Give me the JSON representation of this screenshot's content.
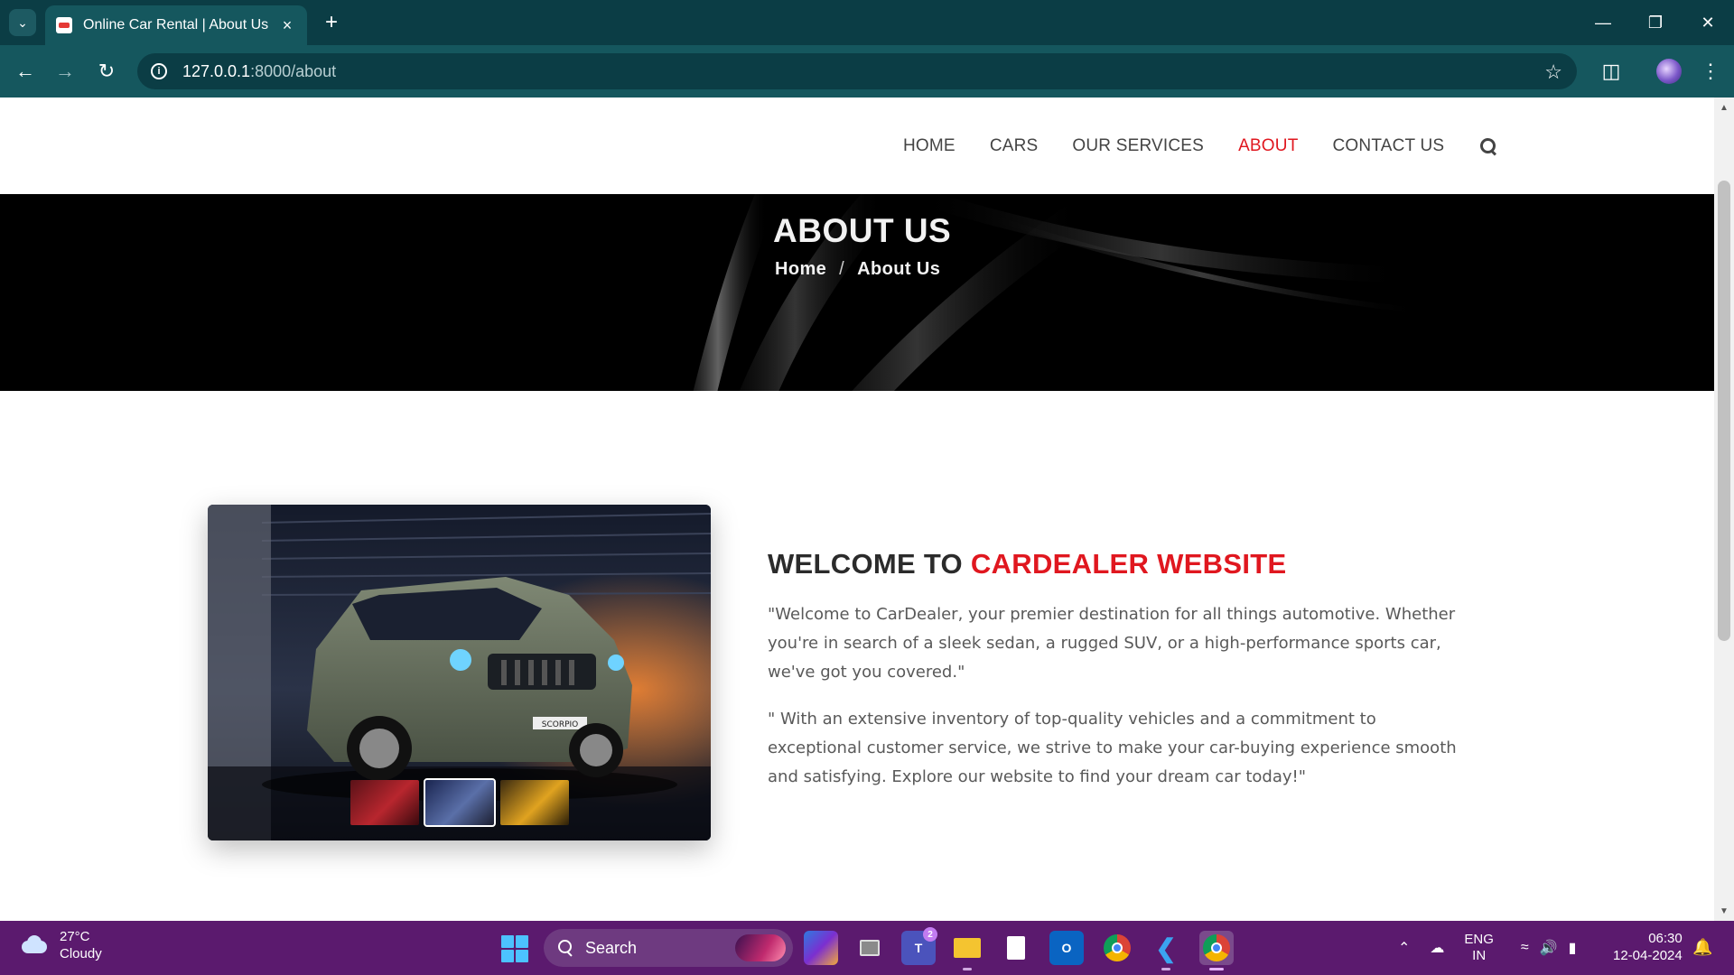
{
  "browser": {
    "tab_title": "Online Car Rental | About Us",
    "url_host": "127.0.0.1",
    "url_path": ":8000/about",
    "icons": [
      "tab-search-icon",
      "favicon-icon",
      "close-icon",
      "plus-icon",
      "minimize-icon",
      "restore-icon",
      "close-window-icon",
      "back-arrow-icon",
      "forward-arrow-icon",
      "reload-icon",
      "site-info-icon",
      "star-icon",
      "extensions-icon",
      "profile-avatar",
      "more-options-icon"
    ]
  },
  "site_nav": {
    "items": [
      {
        "label": "HOME",
        "active": false
      },
      {
        "label": "CARS",
        "active": false
      },
      {
        "label": "OUR SERVICES",
        "active": false
      },
      {
        "label": "ABOUT",
        "active": true
      },
      {
        "label": "CONTACT US",
        "active": false
      }
    ],
    "active_color": "#e0171f"
  },
  "hero": {
    "title": "ABOUT US",
    "breadcrumb_home": "Home",
    "breadcrumb_sep": "/",
    "breadcrumb_current": "About Us"
  },
  "about": {
    "heading_prefix": "WELCOME TO",
    "heading_brand": "CARDEALER WEBSITE",
    "paragraph_1": "\"Welcome to CarDealer, your premier destination for all things automotive. Whether you're in search of a sleek sedan, a rugged SUV, or a high-performance sports car, we've got you covered.\"",
    "paragraph_2": "\" With an extensive inventory of top-quality vehicles and a commitment to exceptional customer service, we strive to make your car-buying experience smooth and satisfying. Explore our website to find your dream car today!\"",
    "car_plate_text": "SCORPIO",
    "thumbnail_colors": [
      "#8e1b22",
      "#3a4a7a",
      "#d89a1a"
    ]
  },
  "taskbar": {
    "weather_temp": "27°C",
    "weather_desc": "Cloudy",
    "search_label": "Search",
    "teams_badge": "2",
    "lang_1": "ENG",
    "lang_2": "IN",
    "time": "06:30",
    "date": "12-04-2024"
  }
}
